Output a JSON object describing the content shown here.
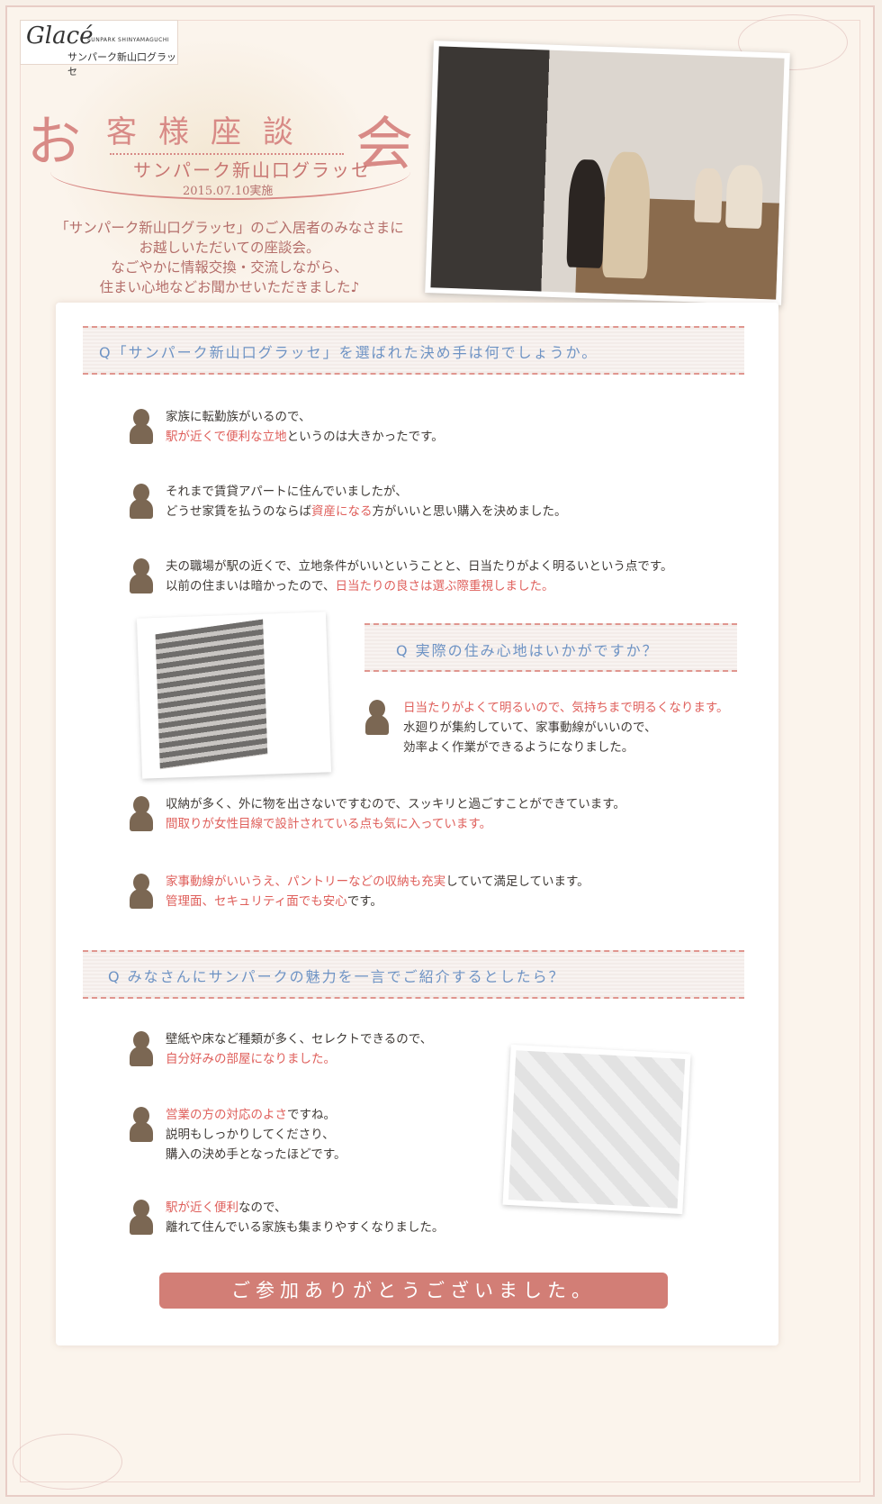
{
  "logo": {
    "brand": "Glacé",
    "sub": "SUNPARK SHINYAMAGUCHI",
    "jp": "サンパーク新山口グラッセ"
  },
  "title": {
    "first": "お",
    "middle": "客様座談",
    "last": "会",
    "subtitle": "サンパーク新山口グラッセ",
    "date": "2015.07.10実施"
  },
  "intro": [
    "「サンパーク新山口グラッセ」のご入居者のみなさまに",
    "お越しいただいての座談会。",
    "なごやかに情報交換・交流しながら、",
    "住まい心地などお聞かせいただきました♪"
  ],
  "q1": {
    "text": "Q「サンパーク新山口グラッセ」を選ばれた決め手は何でしょうか。",
    "answers": [
      {
        "l1": "家族に転勤族がいるので、",
        "l2_em": "駅が近くで便利な立地",
        "l2": "というのは大きかったです。"
      },
      {
        "l1": "それまで賃貸アパートに住んでいましたが、",
        "l2_pre": "どうせ家賃を払うのならば",
        "l2_em": "資産になる",
        "l2": "方がいいと思い購入を決めました。"
      },
      {
        "l1": "夫の職場が駅の近くで、立地条件がいいということと、日当たりがよく明るいという点です。",
        "l2_pre": "以前の住まいは暗かったので、",
        "l2_em": "日当たりの良さは選ぶ際重視しました。"
      }
    ]
  },
  "q2": {
    "text": "Q 実際の住み心地はいかがですか？",
    "a1": {
      "l1_em": "日当たりがよくて明るいので、気持ちまで明るくなります。",
      "l2": "水廻りが集約していて、家事動線がいいので、",
      "l3": "効率よく作業ができるようになりました。"
    },
    "a2": {
      "l1": "収納が多く、外に物を出さないですむので、スッキリと過ごすことができています。",
      "l2_em": "間取りが女性目線で設計されている点も気に入っています。"
    },
    "a3": {
      "l1_em": "家事動線がいいうえ、パントリーなどの収納も充実",
      "l1": "していて満足しています。",
      "l2_em": "管理面、セキュリティ面でも安心",
      "l2": "です。"
    }
  },
  "q3": {
    "text": "Q みなさんにサンパークの魅力を一言でご紹介するとしたら？",
    "a1": {
      "l1": "壁紙や床など種類が多く、セレクトできるので、",
      "l2_em": "自分好みの部屋になりました。"
    },
    "a2": {
      "l1_em": "営業の方の対応のよさ",
      "l1": "ですね。",
      "l2": "説明もしっかりしてくださり、",
      "l3": "購入の決め手となったほどです。"
    },
    "a3": {
      "l1_em": "駅が近く便利",
      "l1": "なので、",
      "l2": "離れて住んでいる家族も集まりやすくなりました。"
    }
  },
  "cta": "ご参加ありがとうございました。",
  "colors": {
    "accent": "#d88a86",
    "question": "#6e93c4",
    "emphasis": "#df5f5b",
    "silhouette": "#7b6753"
  }
}
